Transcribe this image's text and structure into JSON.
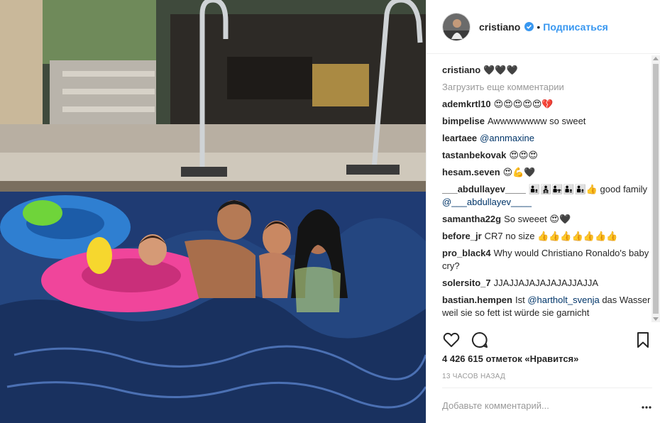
{
  "header": {
    "username": "cristiano",
    "verified_icon": "verified-badge-icon",
    "separator": "•",
    "follow_label": "Подписаться"
  },
  "caption": {
    "username": "cristiano",
    "text": "🖤🖤🖤"
  },
  "load_more_label": "Загрузить еще комментарии",
  "comments": [
    {
      "user": "ademkrtl10",
      "text": "😍😍😍😍😍💔"
    },
    {
      "user": "bimpelise",
      "text": "Awwwwwwww so sweet"
    },
    {
      "user": "leartaee",
      "mention": "@annmaxine",
      "text": ""
    },
    {
      "user": "tastanbekovak",
      "text": "😍😍😍"
    },
    {
      "user": "hesam.seven",
      "text": "😍💪🖤"
    },
    {
      "user": "___abdullayev____",
      "text": "👨‍👦👨‍👦‍👦👨‍👧👨‍👦👨‍👦👍 good family",
      "mention": "@___abdullayev____"
    },
    {
      "user": "samantha22g",
      "text": "So sweeet 😍🖤"
    },
    {
      "user": "before_jr",
      "text": "CR7 no size 👍👍👍👍👍👍👍"
    },
    {
      "user": "pro_black4",
      "text": "Why would Christiano Ronaldo's baby cry?"
    },
    {
      "user": "solersito_7",
      "text": "JJAJJAJAJAJAJAJJAJJA"
    },
    {
      "user": "bastian.hempen",
      "text": "Ist",
      "mention": "@hartholt_svenja",
      "text2": "das Wasser weil sie so fett ist würde sie garnicht"
    }
  ],
  "actions": {
    "like_icon": "heart-icon",
    "comment_icon": "comment-icon",
    "save_icon": "bookmark-icon"
  },
  "likes_text": "4 426 615 отметок «Нравится»",
  "timestamp": "13 часов назад",
  "add_comment": {
    "placeholder": "Добавьте комментарий...",
    "more_icon": "more-options-icon"
  },
  "colors": {
    "link": "#3897f0",
    "mention": "#003569",
    "muted": "#999999",
    "text": "#262626"
  }
}
